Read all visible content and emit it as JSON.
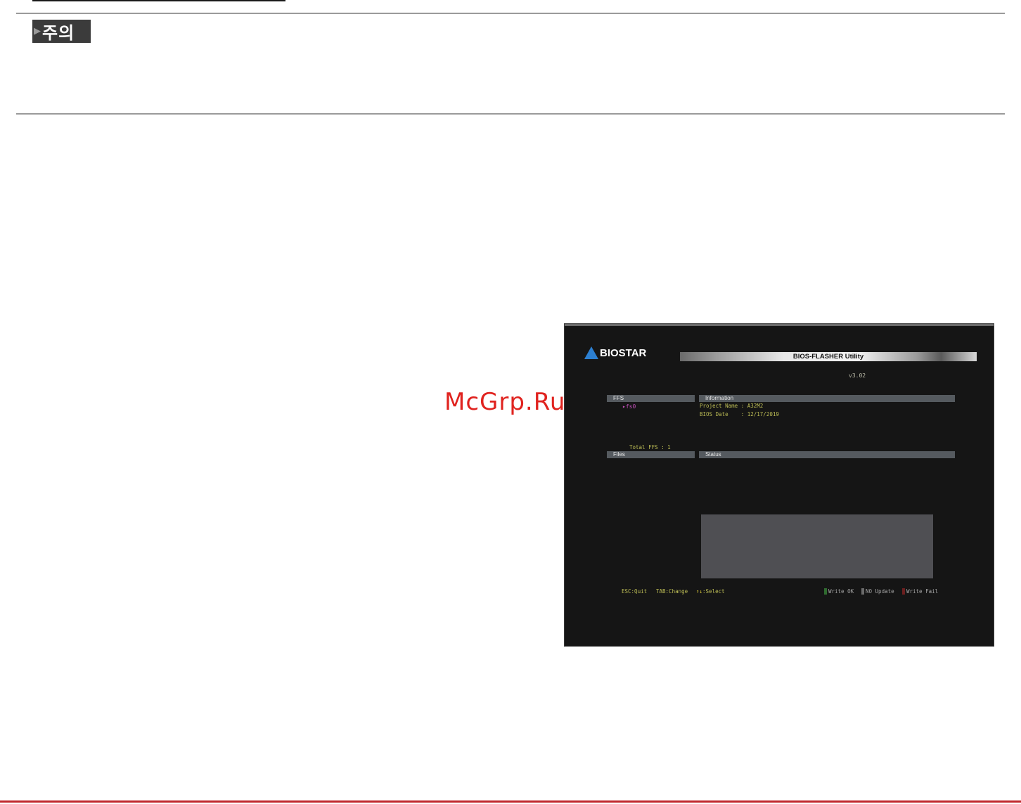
{
  "caution": {
    "label": "주의"
  },
  "watermark": "McGrp.Ru",
  "bios": {
    "brand": "BIOSTAR",
    "title": "BIOS-FLASHER Utility",
    "version": "v3.02",
    "headers": {
      "ffs": "FFS",
      "information": "Information",
      "files": "Files",
      "status": "Status"
    },
    "fs_item": "fs0",
    "info": {
      "project_label": "Project Name",
      "project_sep": ":",
      "project_value": "A32M2",
      "date_label": "BIOS Date",
      "date_sep": ":",
      "date_value": "12/17/2019"
    },
    "total_ffs": "Total FFS : 1",
    "keys": {
      "esc": "ESC:Quit",
      "tab": "TAB:Change",
      "arrows": "↑↓",
      "select": ":Select"
    },
    "legend": [
      {
        "label": "Write OK",
        "color": "#2f6b2f"
      },
      {
        "label": "NO Update",
        "color": "#6a6a6a"
      },
      {
        "label": "Write Fail",
        "color": "#6b1f1f"
      }
    ]
  }
}
